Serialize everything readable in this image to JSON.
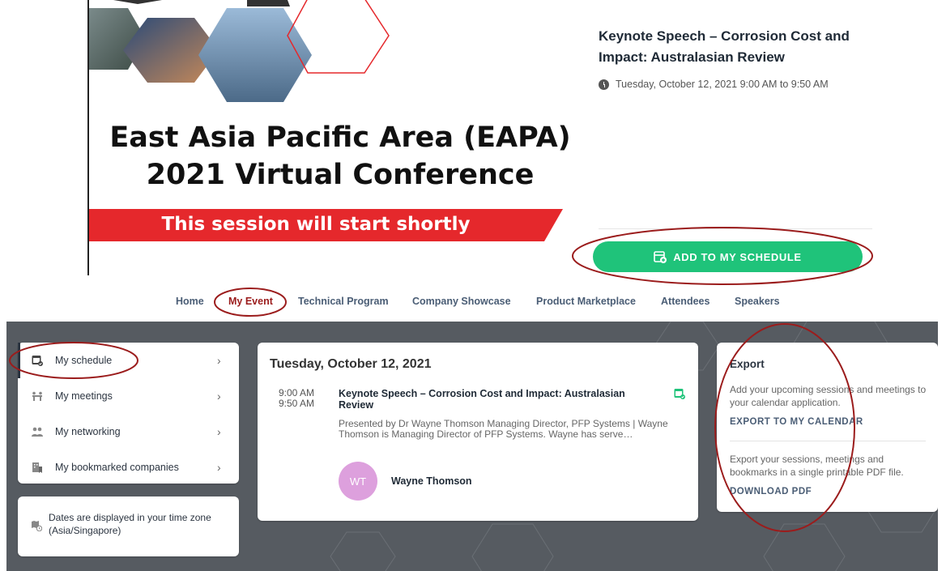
{
  "banner": {
    "title_line1": "East Asia Pacific Area (EAPA)",
    "title_line2": "2021 Virtual Conference",
    "ribbon_text": "This session will start shortly",
    "colors": {
      "ribbon": "#e5282c",
      "hex_outline": "#e5282c"
    }
  },
  "session": {
    "title": "Keynote Speech – Corrosion Cost and Impact: Australasian Review",
    "datetime": "Tuesday, October 12, 2021 9:00 AM to 9:50 AM",
    "add_button_label": "ADD TO MY SCHEDULE",
    "add_button_icon": "calendar-add-icon",
    "colors": {
      "add_button": "#1fc37a"
    }
  },
  "nav": {
    "items": [
      {
        "label": "Home",
        "active": false
      },
      {
        "label": "My Event",
        "active": true
      },
      {
        "label": "Technical Program",
        "active": false
      },
      {
        "label": "Company Showcase",
        "active": false
      },
      {
        "label": "Product Marketplace",
        "active": false
      },
      {
        "label": "Attendees",
        "active": false
      },
      {
        "label": "Speakers",
        "active": false
      }
    ]
  },
  "sidebar": {
    "items": [
      {
        "label": "My schedule",
        "icon": "calendar-check-icon",
        "active": true
      },
      {
        "label": "My meetings",
        "icon": "meeting-icon",
        "active": false
      },
      {
        "label": "My networking",
        "icon": "people-icon",
        "active": false
      },
      {
        "label": "My bookmarked companies",
        "icon": "bookmark-building-icon",
        "active": false
      }
    ],
    "timezone_note": "Dates are displayed in your time zone (Asia/Singapore)",
    "timezone_icon": "map-clock-icon"
  },
  "schedule": {
    "date_heading": "Tuesday, October 12, 2021",
    "item": {
      "start": "9:00 AM",
      "end": "9:50 AM",
      "title": "Keynote Speech – Corrosion Cost and Impact: Australasian Review",
      "description": "Presented by Dr Wayne Thomson Managing Director, PFP Systems | Wayne Thomson is Managing Director of PFP Systems. Wayne has serve…",
      "speaker_initials": "WT",
      "speaker_name": "Wayne Thomson"
    }
  },
  "export": {
    "heading": "Export",
    "calendar_desc": "Add your upcoming sessions and meetings to your calendar application.",
    "calendar_link": "EXPORT TO MY CALENDAR",
    "pdf_desc": "Export your sessions, meetings and bookmarks in a single printable PDF file.",
    "pdf_link": "DOWNLOAD PDF"
  },
  "colors": {
    "dark_background": "#565b61",
    "nav_text": "#4a5d75",
    "annotation": "#9b1c1c"
  }
}
